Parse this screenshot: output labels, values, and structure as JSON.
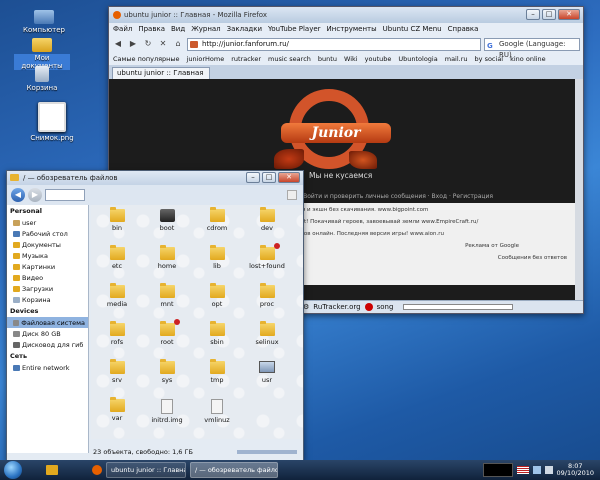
{
  "desktop": {
    "icons": [
      {
        "label": "Компьютер"
      },
      {
        "label": "Мои документы"
      },
      {
        "label": "Корзина"
      },
      {
        "label": "Снимок.png"
      }
    ]
  },
  "firefox": {
    "title": "ubuntu junior :: Главная - Mozilla Firefox",
    "menu": [
      "Файл",
      "Правка",
      "Вид",
      "Журнал",
      "Закладки",
      "YouTube Player",
      "Инструменты",
      "Ubuntu CZ Menu",
      "Справка"
    ],
    "url": "http://junior.fanforum.ru/",
    "search_placeholder": "Google (Language: RU)",
    "bookmarks": [
      "Самые популярные",
      "juniorHome",
      "rutracker",
      "music search",
      "buntu",
      "Wiki",
      "youtube",
      "Ubuntologia",
      "mail.ru",
      "by social",
      "kino online"
    ],
    "tab_label": "ubuntu junior :: Главная",
    "page": {
      "logo_text": "Junior",
      "tagline": "Мы не кусаемся",
      "nav_text": "Профиль · Войти и проверить личные сообщения · Вход · Регистрация",
      "ad_lines": [
        "Стратегия и экшн без скачивания.  www.bigpoint.com",
        "mpire Craft! Покачивай героев, завоевывай земли  www.EmpireCraft.ru/",
        "320 игроков онлайн. Последняя версия игры!  www.aion.ru"
      ],
      "ads_by": "Реклама от Google",
      "footer_note": "Сообщения без ответов"
    },
    "statusbar": {
      "rutracker": "RuTracker.org",
      "song": "song"
    }
  },
  "filemanager": {
    "title": "/ — обозреватель файлов",
    "sidebar": {
      "personal_header": "Personal",
      "personal": [
        "user",
        "Рабочий стол",
        "Документы",
        "Музыка",
        "Картинки",
        "Видео",
        "Загрузки",
        "Корзина"
      ],
      "devices_header": "Devices",
      "devices": [
        "Файловая система",
        "Диск 80 GB",
        "Дисковод для гиб"
      ],
      "network_header": "Сеть",
      "network": [
        "Entire network"
      ]
    },
    "files": [
      {
        "name": "bin",
        "kind": "folder"
      },
      {
        "name": "boot",
        "kind": "special"
      },
      {
        "name": "cdrom",
        "kind": "folder"
      },
      {
        "name": "dev",
        "kind": "folder"
      },
      {
        "name": "etc",
        "kind": "folder"
      },
      {
        "name": "home",
        "kind": "folder"
      },
      {
        "name": "lib",
        "kind": "folder"
      },
      {
        "name": "lost+found",
        "kind": "locked"
      },
      {
        "name": "media",
        "kind": "folder"
      },
      {
        "name": "mnt",
        "kind": "folder"
      },
      {
        "name": "opt",
        "kind": "folder"
      },
      {
        "name": "proc",
        "kind": "folder"
      },
      {
        "name": "rofs",
        "kind": "folder"
      },
      {
        "name": "root",
        "kind": "locked"
      },
      {
        "name": "sbin",
        "kind": "folder"
      },
      {
        "name": "selinux",
        "kind": "folder"
      },
      {
        "name": "srv",
        "kind": "folder"
      },
      {
        "name": "sys",
        "kind": "folder"
      },
      {
        "name": "tmp",
        "kind": "folder"
      },
      {
        "name": "usr",
        "kind": "computer"
      },
      {
        "name": "var",
        "kind": "folder"
      },
      {
        "name": "initrd.img",
        "kind": "file"
      },
      {
        "name": "vmlinuz",
        "kind": "file"
      }
    ],
    "status": "23 объекта, свободно: 1,6 ГБ"
  },
  "taskbar": {
    "items": [
      "ubuntu junior :: Главная",
      "/ — обозреватель файлов"
    ],
    "time": "8:07",
    "date": "09/10/2010"
  }
}
